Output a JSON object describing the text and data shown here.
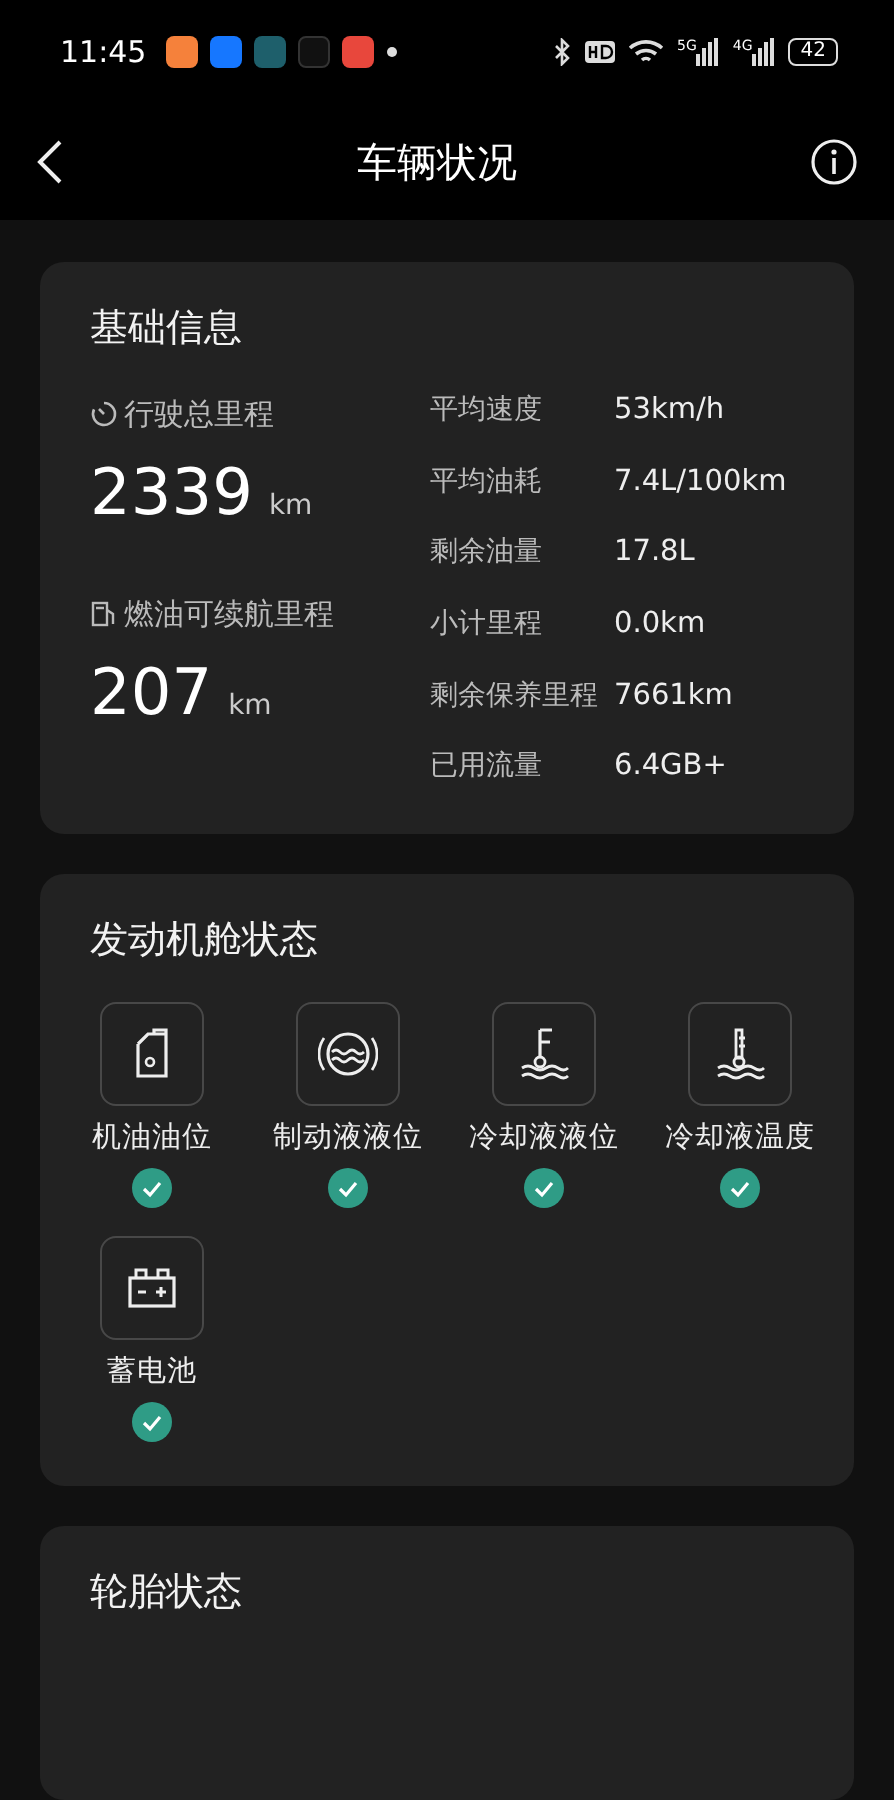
{
  "status_bar": {
    "time": "11:45",
    "network_5g": "5G",
    "network_4g": "4G",
    "battery": "42"
  },
  "header": {
    "title": "车辆状况"
  },
  "basic_info": {
    "title": "基础信息",
    "total_mileage": {
      "label": "行驶总里程",
      "value": "2339",
      "unit": "km"
    },
    "fuel_range": {
      "label": "燃油可续航里程",
      "value": "207",
      "unit": "km"
    },
    "stats": [
      {
        "label": "平均速度",
        "value": "53km/h"
      },
      {
        "label": "平均油耗",
        "value": "7.4L/100km"
      },
      {
        "label": "剩余油量",
        "value": "17.8L"
      },
      {
        "label": "小计里程",
        "value": "0.0km"
      },
      {
        "label": "剩余保养里程",
        "value": "7661km"
      },
      {
        "label": "已用流量",
        "value": "6.4GB+"
      }
    ]
  },
  "engine_status": {
    "title": "发动机舱状态",
    "items": [
      {
        "label": "机油油位",
        "ok": true
      },
      {
        "label": "制动液液位",
        "ok": true
      },
      {
        "label": "冷却液液位",
        "ok": true
      },
      {
        "label": "冷却液温度",
        "ok": true
      },
      {
        "label": "蓄电池",
        "ok": true
      }
    ]
  },
  "tire_status": {
    "title": "轮胎状态"
  }
}
